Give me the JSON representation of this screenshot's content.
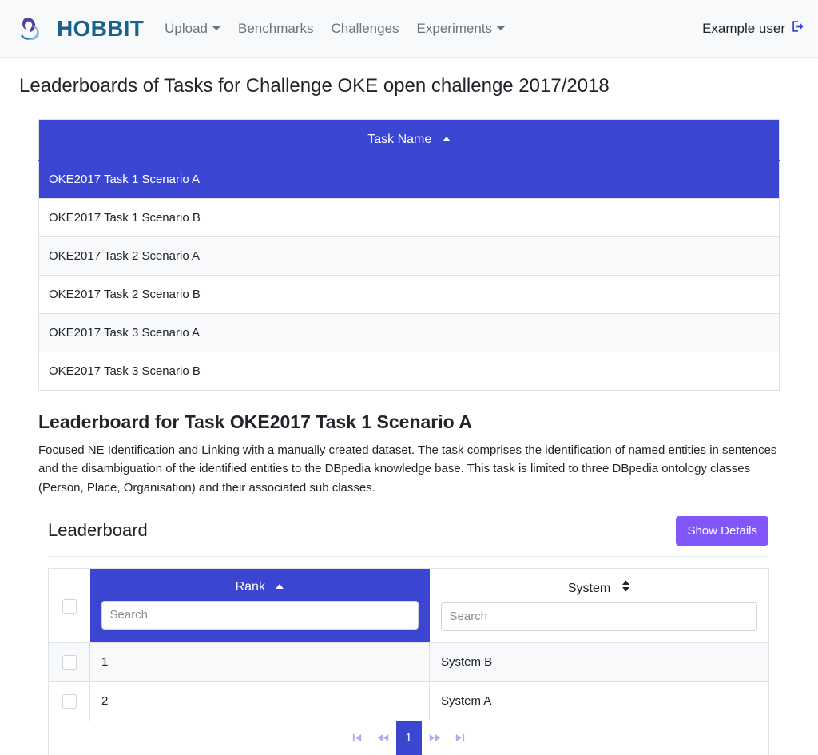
{
  "navbar": {
    "brand": "HOBBIT",
    "brand_color": "#17618c",
    "logo_icon": "hobbit-creature-logo",
    "links": [
      {
        "label": "Upload",
        "has_dropdown": true
      },
      {
        "label": "Benchmarks",
        "has_dropdown": false
      },
      {
        "label": "Challenges",
        "has_dropdown": false
      },
      {
        "label": "Experiments",
        "has_dropdown": true
      }
    ],
    "user": {
      "label": "Example user",
      "icon": "sign-out-icon",
      "icon_color": "#3a46d2"
    }
  },
  "page": {
    "title": "Leaderboards of Tasks for Challenge OKE open challenge 2017/2018",
    "accent_color": "#3a46d2",
    "purple_color": "#8257fa"
  },
  "task_table": {
    "header": {
      "label": "Task Name",
      "sort_icon": "sort-ascending-icon"
    },
    "rows": [
      {
        "name": "OKE2017 Task 1 Scenario A",
        "selected": true
      },
      {
        "name": "OKE2017 Task 1 Scenario B",
        "selected": false
      },
      {
        "name": "OKE2017 Task 2 Scenario A",
        "selected": false
      },
      {
        "name": "OKE2017 Task 2 Scenario B",
        "selected": false
      },
      {
        "name": "OKE2017 Task 3 Scenario A",
        "selected": false
      },
      {
        "name": "OKE2017 Task 3 Scenario B",
        "selected": false
      }
    ]
  },
  "leaderboard_section": {
    "title": "Leaderboard for Task OKE2017 Task 1 Scenario A",
    "description": "Focused NE Identification and Linking with a manually created dataset. The task comprises the identification of named entities in sentences and the disambiguation of the identified entities to the DBpedia knowledge base. This task is limited to three DBpedia ontology classes (Person, Place, Organisation) and their associated sub classes.",
    "card_title": "Leaderboard",
    "show_details_label": "Show Details"
  },
  "leaderboard_table": {
    "columns": [
      {
        "label": "Rank",
        "sort_icon": "sort-ascending-icon",
        "sorted": true,
        "search_placeholder": "Search",
        "search_value": ""
      },
      {
        "label": "System",
        "sort_icon": "sort-both-icon",
        "sorted": false,
        "search_placeholder": "Search",
        "search_value": ""
      }
    ],
    "rows": [
      {
        "rank": "1",
        "system": "System B",
        "checked": false
      },
      {
        "rank": "2",
        "system": "System A",
        "checked": false
      }
    ]
  },
  "pagination": {
    "first_label": "first-page",
    "prev_label": "previous-page",
    "current_page": "1",
    "next_label": "next-page",
    "last_label": "last-page"
  }
}
